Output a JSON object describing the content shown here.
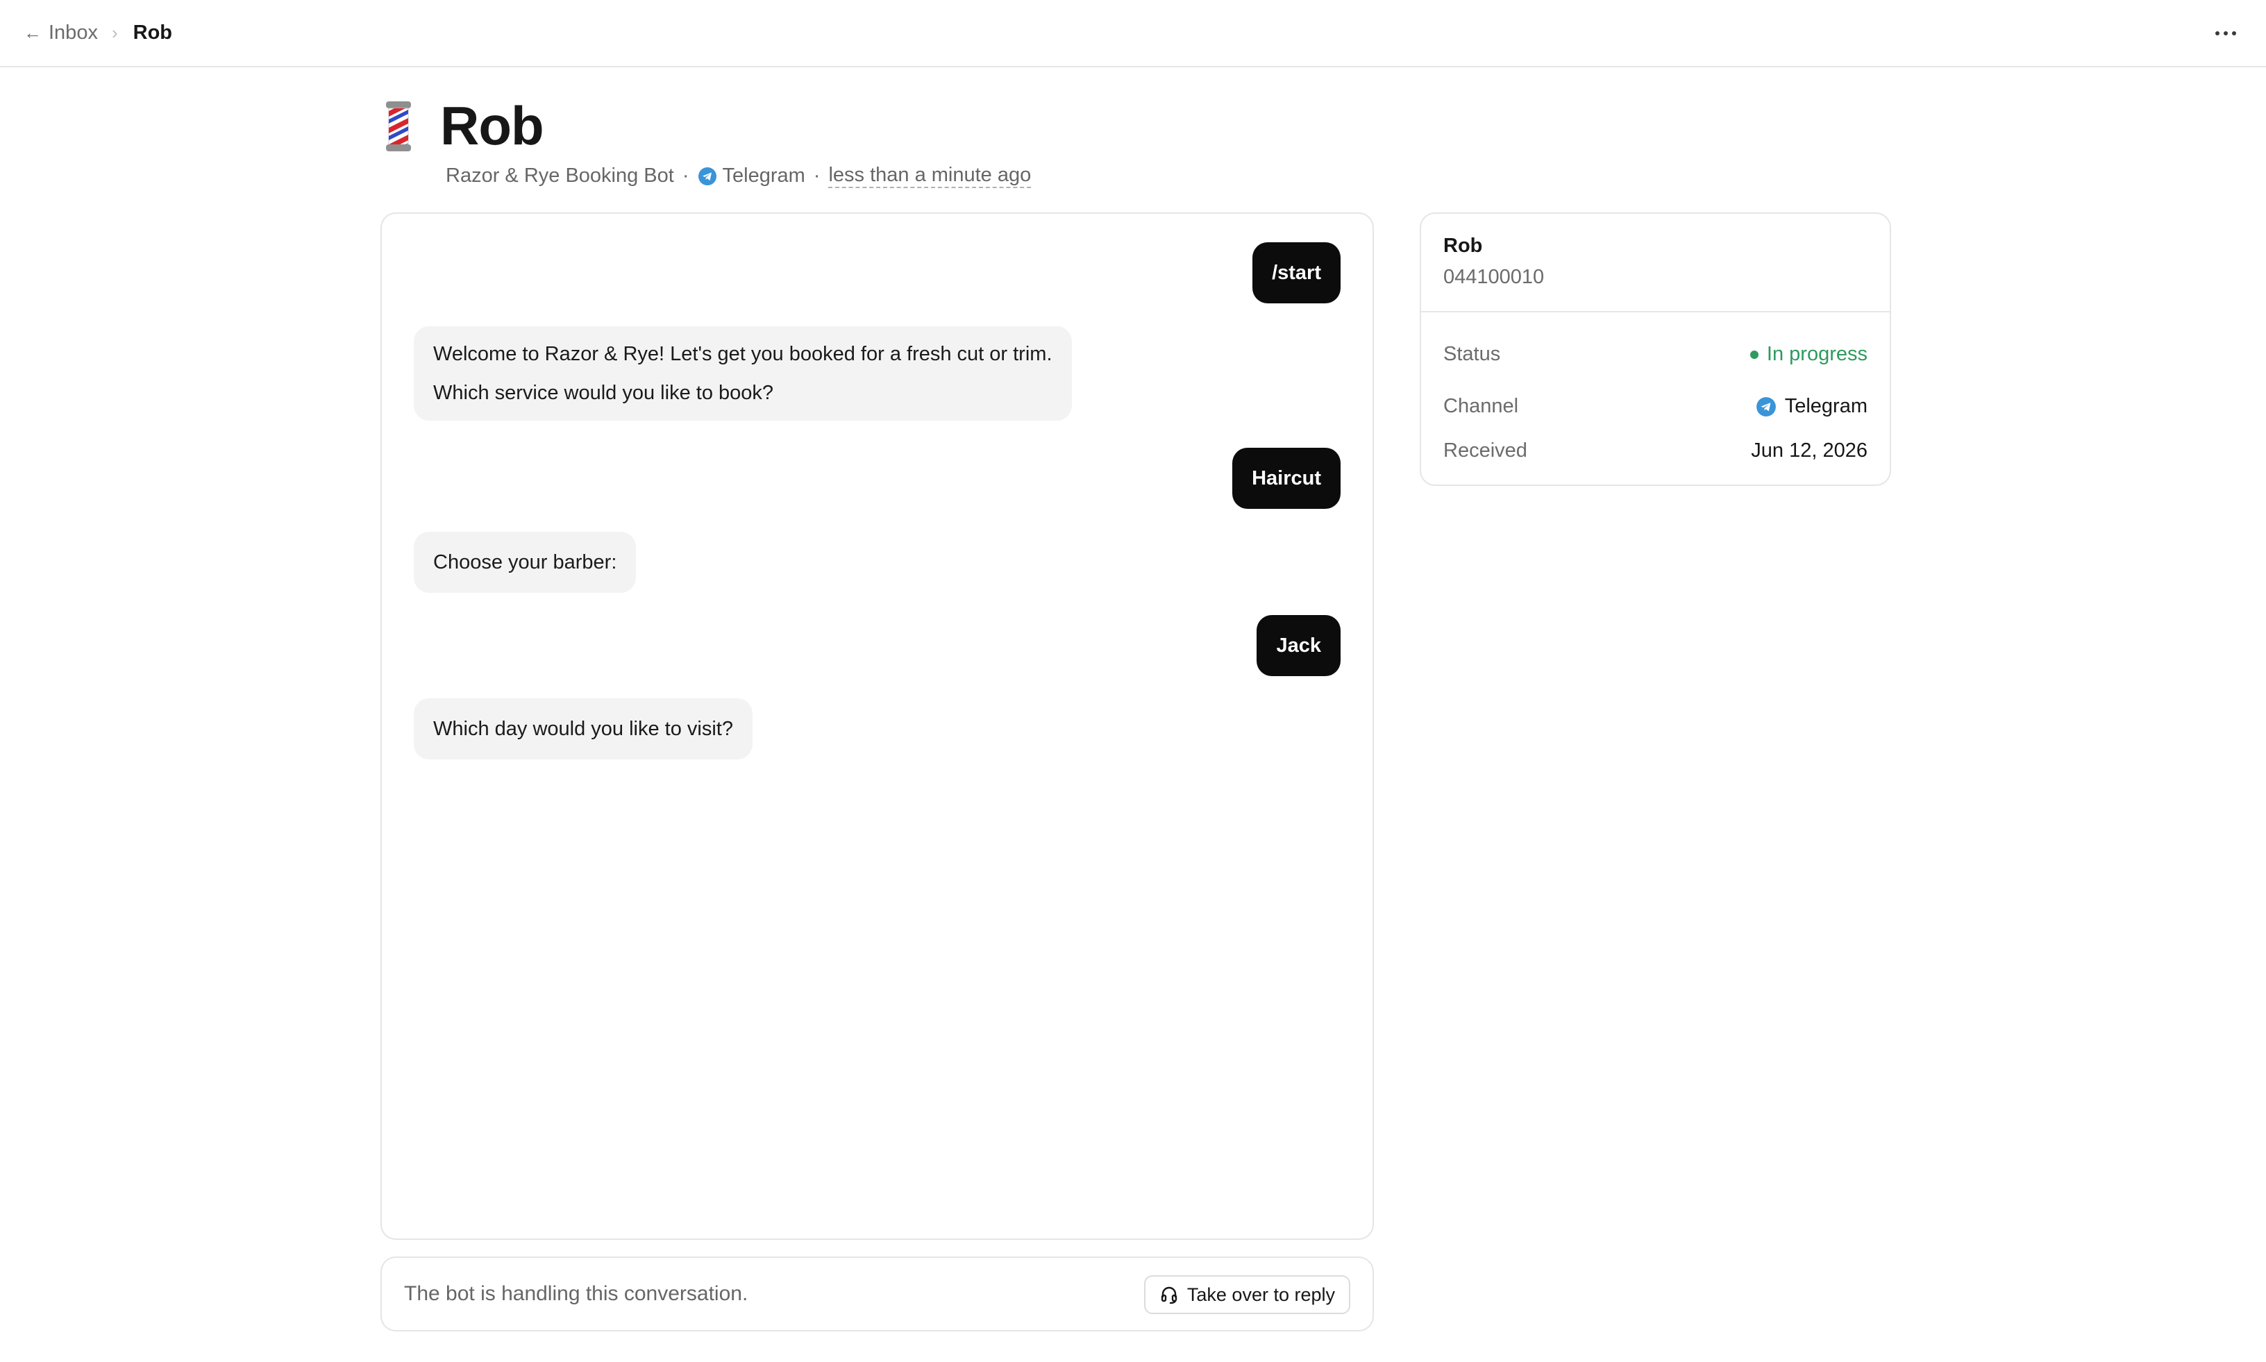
{
  "breadcrumb": {
    "back_label": "Inbox",
    "current": "Rob"
  },
  "header": {
    "title": "Rob",
    "icon": "barber-pole-icon",
    "bot_name": "Razor & Rye Booking Bot",
    "channel": "Telegram",
    "time_ago": "less than a minute ago",
    "separator": "·"
  },
  "messages": [
    {
      "direction": "outgoing",
      "text": "/start"
    },
    {
      "direction": "incoming",
      "lines": [
        "Welcome to Razor & Rye! Let's get you booked for a fresh cut or trim.",
        "Which service would you like to book?"
      ]
    },
    {
      "direction": "outgoing",
      "text": "Haircut"
    },
    {
      "direction": "incoming",
      "text": "Choose your barber:"
    },
    {
      "direction": "outgoing",
      "text": "Jack"
    },
    {
      "direction": "incoming",
      "text": "Which day would you like to visit?"
    }
  ],
  "footer": {
    "status_text": "The bot is handling this conversation.",
    "takeover_label": "Take over to reply"
  },
  "contact": {
    "name": "Rob",
    "phone": "044100010",
    "rows": {
      "status_label": "Status",
      "status_value": "In progress",
      "channel_label": "Channel",
      "channel_value": "Telegram",
      "received_label": "Received",
      "received_value": "Jun 12, 2026"
    }
  },
  "colors": {
    "status_green": "#2e9a5f",
    "telegram_blue": "#3a94d8",
    "outgoing_bubble": "#0c0c0c",
    "incoming_bubble": "#f3f3f3"
  }
}
